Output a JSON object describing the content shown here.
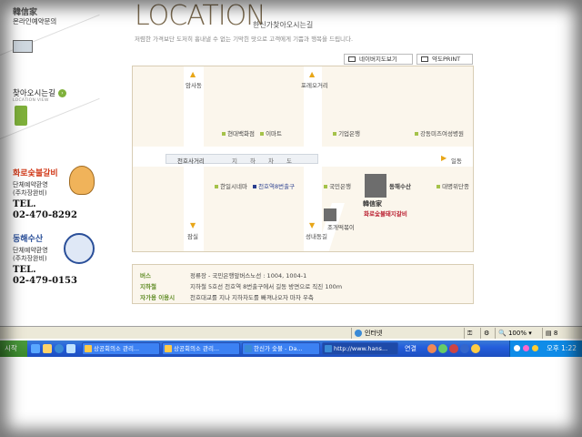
{
  "sidebar": {
    "brand": "韓信家",
    "brand_sub": "온라인예약문의",
    "menu_directions": "찾아오시는길",
    "menu_directions_sub": "LOCATION VIEW",
    "store1": {
      "name": "화로숯불갈비",
      "note1": "단체예약환영",
      "note2": "(주차장완비)",
      "tel_label": "TEL.",
      "tel": "02-470-8292"
    },
    "store2": {
      "name": "동해수산",
      "note1": "단체예약환영",
      "note2": "(주차장완비)",
      "tel_label": "TEL.",
      "tel": "02-479-0153"
    }
  },
  "header": {
    "title": "LOCATION",
    "title_sub": "한신가찾아오시는길",
    "desc": "저렴한 가격보단 도저히 흉내낼 수 없는 기막힌 맛으로 고객에게 기쁨과 행복을 드립니다."
  },
  "buttons": {
    "naver_map": "네이버지도보기",
    "print_map": "약도PRINT"
  },
  "map": {
    "labels": {
      "amsa": "암사동",
      "olympic": "포레오거리",
      "hyundai": "현대백화점",
      "emart": "이마트",
      "kiup": "기업은행",
      "gangdong_clinic": "강동미즈여성병원",
      "cheonho_st": "천호사거리",
      "subway": "지하차도",
      "ildong": "일동",
      "hanil": "한일시네마",
      "exit8": "천호역8번출구",
      "kookmin": "국민은행",
      "donghae": "동해수산",
      "daemyung": "대명위단종",
      "jamsil": "잠실",
      "jogae": "조개떡볶이",
      "seongnae": "성내동길",
      "hanshin_brand": "韓信家",
      "hanshin_sub": "화로숯불돼지갈비"
    }
  },
  "info": {
    "rows": [
      {
        "key": "버스",
        "val": "정류장 - 국민은행앞버스노선 : 1004, 1004-1"
      },
      {
        "key": "지하철",
        "val": "지하철 5호선 천호역 8번출구에서 길동 방면으로 직진 100m"
      },
      {
        "key": "자가용 이용시",
        "val": "천호대교를 지나 지하차도를 빠져나오자 마자 우측"
      }
    ]
  },
  "statusbar": {
    "zone": "인터넷",
    "zoom": "100%",
    "count": "8"
  },
  "taskbar": {
    "start": "시작",
    "tasks": [
      "상공회의소 관리...",
      "상공회의소 관리...",
      "한신가 숯불 - Da...",
      "http://www.hans..."
    ],
    "addr_label": "연결",
    "time": "오후 1:22"
  }
}
